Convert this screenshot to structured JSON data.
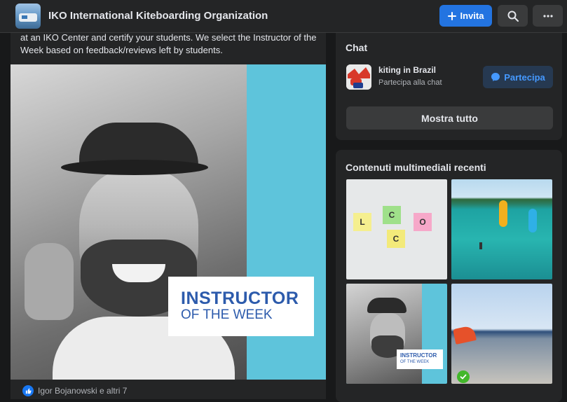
{
  "header": {
    "group_title": "IKO International Kiteboarding Organization",
    "invite_label": "Invita",
    "invite_icon": "plus-icon",
    "search_icon": "search-icon",
    "more_icon": "more-dots-icon"
  },
  "post": {
    "text": "at an IKO Center and certify your students. We select the Instructor of the Week based on feedback/reviews left by students.",
    "image_card_line1": "INSTRUCTOR",
    "image_card_line2": "OF THE WEEK",
    "reactions_text": "Igor Bojanowski e altri 7",
    "reaction_icon": "like-icon"
  },
  "chat": {
    "title": "Chat",
    "room_name": "kiting in Brazil",
    "room_sub": "Partecipa alla chat",
    "join_label": "Partecipa",
    "join_icon": "messenger-icon",
    "show_all_label": "Mostra tutto"
  },
  "media": {
    "title": "Contenuti multimediali recenti",
    "stickies": [
      "L",
      "C",
      "O",
      "C"
    ],
    "thumb_card_line1": "INSTRUCTOR",
    "thumb_card_line2": "OF THE WEEK"
  },
  "colors": {
    "accent": "#2374e1",
    "background": "#18191a",
    "surface": "#242526",
    "brand_blue": "#2d5bac"
  }
}
